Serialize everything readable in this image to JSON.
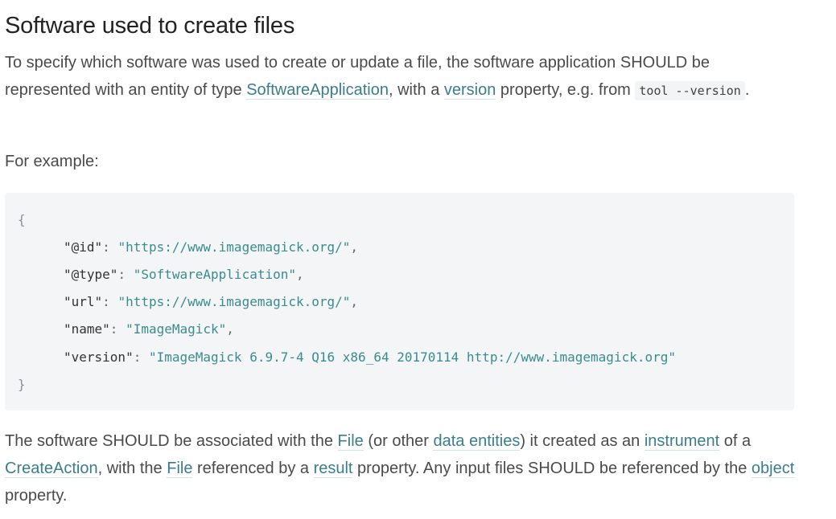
{
  "section": {
    "title": "Software used to create files"
  },
  "intro": {
    "t1": "To specify which software was used to create or update a file, the software application SHOULD be represented with an entity of type ",
    "link_software_application": "SoftwareApplication",
    "t2": ", with a ",
    "link_version": "version",
    "t3": " property, e.g. from ",
    "code_tool_version": "tool --version",
    "t4": "."
  },
  "for_example": "For example:",
  "code": {
    "open_brace": "{",
    "close_brace": "}",
    "lines": [
      {
        "key": "\"@id\"",
        "value": "\"https://www.imagemagick.org/\"",
        "tail": ","
      },
      {
        "key": "\"@type\"",
        "value": "\"SoftwareApplication\"",
        "tail": ","
      },
      {
        "key": "\"url\"",
        "value": "\"https://www.imagemagick.org/\"",
        "tail": ","
      },
      {
        "key": "\"name\"",
        "value": "\"ImageMagick\"",
        "tail": ","
      },
      {
        "key": "\"version\"",
        "value": "\"ImageMagick 6.9.7-4 Q16 x86_64 20170114 http://www.imagemagick.org\"",
        "tail": ""
      }
    ]
  },
  "outro": {
    "t1": "The software SHOULD be associated with the ",
    "link_file_1": "File",
    "t2": " (or other ",
    "link_data_entities": "data entities",
    "t3": ") it created as an ",
    "link_instrument": "instrument",
    "t4": " of a ",
    "link_create_action": "CreateAction",
    "t5": ", with the ",
    "link_file_2": "File",
    "t6": " referenced by a ",
    "link_result": "result",
    "t7": " property. Any input files SHOULD be referenced by the ",
    "link_object": "object",
    "t8": " property."
  },
  "colors": {
    "link": "#3a7d8c",
    "code_string": "#3a8c8c",
    "code_background": "#f4f5f7"
  }
}
